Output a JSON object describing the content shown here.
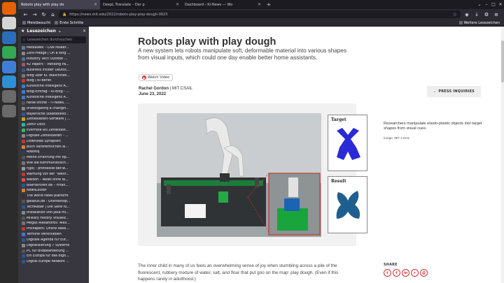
{
  "dock": {
    "apps": [
      {
        "name": "firefox-icon",
        "color": "#e66000"
      },
      {
        "name": "files-icon",
        "color": "#d5d5d5"
      },
      {
        "name": "writer-icon",
        "color": "#2a6ebb"
      },
      {
        "name": "chrome-icon",
        "color": "#34a853"
      },
      {
        "name": "screenshot-icon",
        "color": "#3d7fd6"
      },
      {
        "name": "vscode-icon",
        "color": "#2d8fd6"
      },
      {
        "name": "usb-icon",
        "color": "#6a6a6a"
      },
      {
        "name": "usb2-icon",
        "color": "#6a6a6a"
      }
    ]
  },
  "tabs": [
    {
      "label": "Robots play with play do",
      "active": true
    },
    {
      "label": "DeepL Translate – Der p",
      "active": false
    },
    {
      "label": "Dashboard ‹ KI-News — Wo",
      "active": false
    }
  ],
  "navbar": {
    "url": "https://news.mit.edu/2022/robots-play-play-dough-0623"
  },
  "bookmarks_bar": {
    "items": [
      "Meistbesucht",
      "Erste Schritte"
    ],
    "other": "Weitere Lesezeichen"
  },
  "sidebar": {
    "title": "Lesezeichen",
    "search_placeholder": "Lesezeichen durchsuchen",
    "items": [
      {
        "label": "MediaWell – Live resear...",
        "color": "#5a7fa8"
      },
      {
        "label": "Zero-Hedge | On a long ...",
        "color": "#888"
      },
      {
        "label": "Industry Tech Outlook ...",
        "color": "#4a6fa5"
      },
      {
        "label": "42 Papers - Trending Pa...",
        "color": "#a55"
      },
      {
        "label": "Business Insider Deutsc...",
        "color": "#2b5797"
      },
      {
        "label": "Blog über KI, Maschinell...",
        "color": "#777"
      },
      {
        "label": "Blog | KI Berlin",
        "color": "#c0392b"
      },
      {
        "label": "Künstliche Intelligenz A...",
        "color": "#3a7bd5"
      },
      {
        "label": "Blog-Eintrag – KI-Blog - ...",
        "color": "#3a7bd5"
      },
      {
        "label": "Künstliche Intelligenz A...",
        "color": "#3a7bd5"
      },
      {
        "label": "heise online – IT-News, ...",
        "color": "#555"
      },
      {
        "label": "Investigating a changin...",
        "color": "#888"
      },
      {
        "label": "Bayerische Staatsbiblio...",
        "color": "#2b5797"
      },
      {
        "label": "Zettelkasten-Software | ...",
        "color": "#d4a017"
      },
      {
        "label": "Zettlr Docs",
        "color": "#1abc9c"
      },
      {
        "label": "Evernote als Zettelkast...",
        "color": "#2dbe60"
      },
      {
        "label": "Digitale Zettelkästen - ...",
        "color": "#888"
      },
      {
        "label": "Download Synapsen",
        "color": "#c0392b"
      },
      {
        "label": "Buch veröffentlichen al...",
        "color": "#e67e22"
      },
      {
        "label": "Robotiq",
        "color": "#2c3e50"
      },
      {
        "label": "Meine Erfahrung mit ep...",
        "color": "#555"
      },
      {
        "label": "Wie die Kommunistisch...",
        "color": "#777"
      },
      {
        "label": "f(ge) - protokolle-der-w...",
        "color": "#999"
      },
      {
        "label": "Warnung vor der \"Weltr...",
        "color": "#c0392b"
      },
      {
        "label": "watson – News ohne Bl...",
        "color": "#e74c3c"
      },
      {
        "label": "Boersentreff.de – Finan...",
        "color": "#2b5797"
      },
      {
        "label": "NewsLocker",
        "color": "#e67e22"
      },
      {
        "label": "The world news platform",
        "color": "#333"
      },
      {
        "label": "galaxus.de - Onlineshop...",
        "color": "#555"
      },
      {
        "label": "TechRadar | Die Seite fü...",
        "color": "#2b5797"
      },
      {
        "label": "Installation von Java mi...",
        "color": "#888"
      },
      {
        "label": "Military History Visualiz...",
        "color": "#555"
      },
      {
        "label": "Megas Alexandros: Alex...",
        "color": "#777"
      },
      {
        "label": "PhilPapers: Online Rese...",
        "color": "#c0392b"
      },
      {
        "label": "Termine verschieben",
        "color": "#3a7bd5"
      },
      {
        "label": "Digitale Agenda für Eur...",
        "color": "#2b5797"
      },
      {
        "label": "Digitalisierung 7 Systems",
        "color": "#888"
      },
      {
        "label": "PC für Bildbearbeitung ...",
        "color": "#555"
      },
      {
        "label": "Ein Europa für das digit...",
        "color": "#2b5797"
      },
      {
        "label": "Digital Europe network ...",
        "color": "#2b5797"
      }
    ]
  },
  "article": {
    "title": "Robots play with play dough",
    "subtitle": "A new system lets robots manipulate soft, deformable material into various shapes from visual inputs, which could one day enable better home assistants.",
    "watch_video": "Watch Video",
    "author": "Rachel Gordon",
    "affiliation": "| MIT CSAIL",
    "date": "June 23, 2022",
    "press_inquiries": "PRESS INQUIRIES",
    "image": {
      "target_label": "Target",
      "result_label": "Result"
    },
    "caption": "Researchers manipulate elasto-plastic objects into target shapes from visual cues.",
    "image_credit": "Image: MIT CSAIL",
    "body": "The inner child in many of us feels an overwhelming sense of joy when stumbling across a pile of the fluorescent, rubbery mixture of water, salt, and flour that put goo on the map: play dough. (Even if this happens rarely in adulthood.)",
    "share_label": "SHARE",
    "share_buttons": [
      {
        "name": "twitter",
        "glyph": "t"
      },
      {
        "name": "facebook",
        "glyph": "f"
      },
      {
        "name": "linkedin",
        "glyph": "in"
      },
      {
        "name": "reddit",
        "glyph": "r"
      },
      {
        "name": "print",
        "glyph": "⎙"
      }
    ]
  }
}
